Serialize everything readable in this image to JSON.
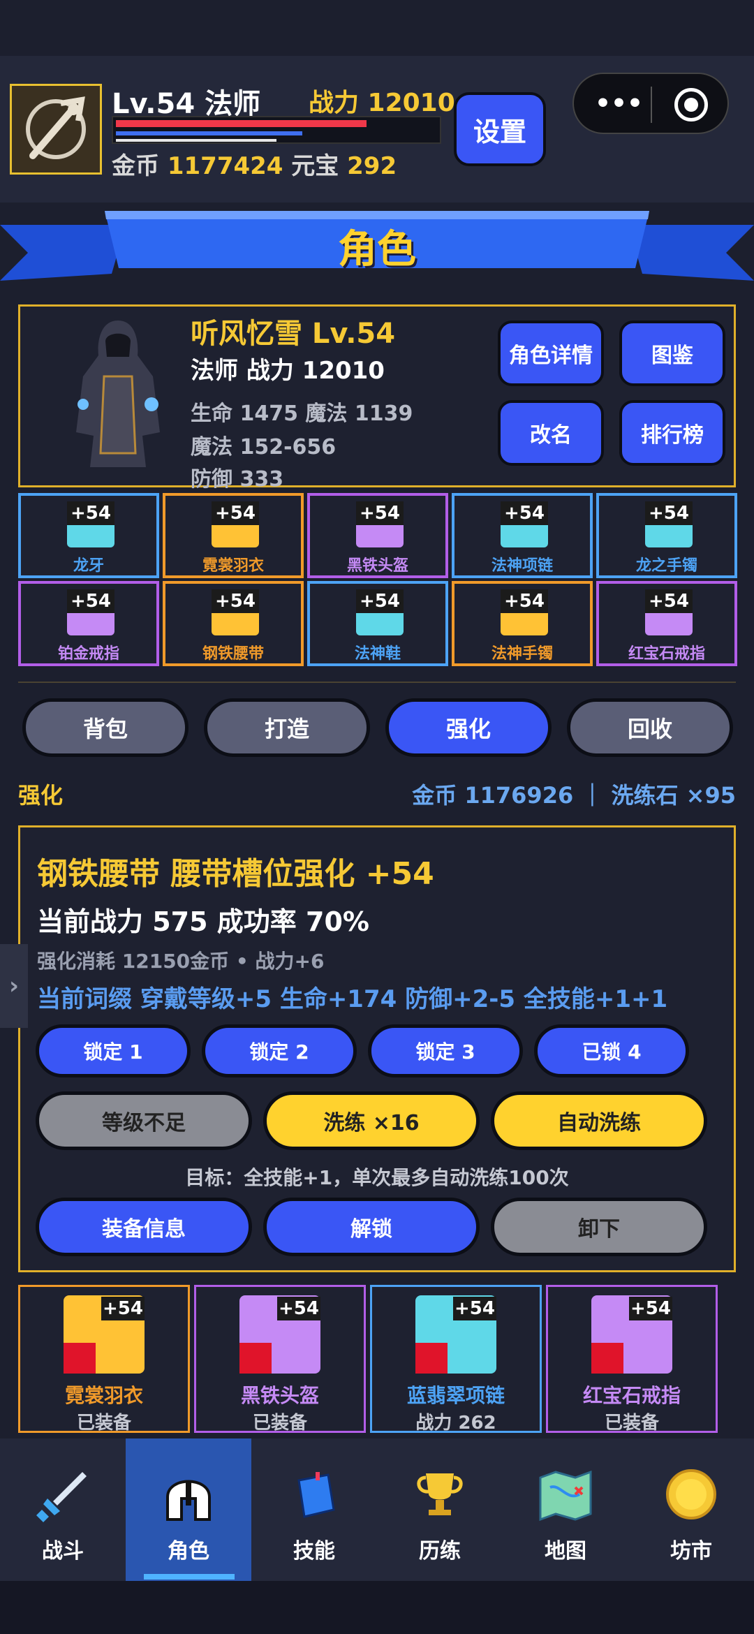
{
  "header": {
    "level_label": "Lv.54 法师",
    "power_label": "战力 12010",
    "gold_label": "金币",
    "gold_value": "1177424",
    "yuanbao_label": "元宝",
    "yuanbao_value": "292",
    "hp_fraction": 0.78,
    "mp_fraction": 0.58,
    "xp_fraction": 0.5,
    "settings_label": "设置"
  },
  "capsule": {
    "menu_icon": "more-dots-icon",
    "close_icon": "target-circle-icon"
  },
  "page": {
    "title": "角色"
  },
  "character": {
    "name_line": "听风忆雪  Lv.54",
    "class_line": "法师  战力 12010",
    "stat_hp_mp": "生命 1475  魔法 1139",
    "stat_magic": "魔法 152-656",
    "stat_defense": "防御 333",
    "buttons": [
      "角色详情",
      "图鉴",
      "改名",
      "排行榜"
    ]
  },
  "equipment_slots": [
    {
      "level": "+54",
      "name": "龙牙",
      "color": "#4da3f5",
      "icon_bg": "#5fd8e8",
      "name_color": "#4da3f5"
    },
    {
      "level": "+54",
      "name": "霓裳羽衣",
      "color": "#f09a2a",
      "icon_bg": "#ffc235",
      "name_color": "#f09a2a"
    },
    {
      "level": "+54",
      "name": "黑铁头盔",
      "color": "#b25ee8",
      "icon_bg": "#c58af5",
      "name_color": "#c58af5"
    },
    {
      "level": "+54",
      "name": "法神项链",
      "color": "#4da3f5",
      "icon_bg": "#5fd8e8",
      "name_color": "#4da3f5"
    },
    {
      "level": "+54",
      "name": "龙之手镯",
      "color": "#4da3f5",
      "icon_bg": "#5fd8e8",
      "name_color": "#4da3f5"
    },
    {
      "level": "+54",
      "name": "铂金戒指",
      "color": "#b25ee8",
      "icon_bg": "#c58af5",
      "name_color": "#c58af5"
    },
    {
      "level": "+54",
      "name": "钢铁腰带",
      "color": "#f09a2a",
      "icon_bg": "#ffc235",
      "name_color": "#f09a2a"
    },
    {
      "level": "+54",
      "name": "法神鞋",
      "color": "#4da3f5",
      "icon_bg": "#5fd8e8",
      "name_color": "#4da3f5"
    },
    {
      "level": "+54",
      "name": "法神手镯",
      "color": "#f09a2a",
      "icon_bg": "#ffc235",
      "name_color": "#f09a2a"
    },
    {
      "level": "+54",
      "name": "红宝石戒指",
      "color": "#b25ee8",
      "icon_bg": "#c58af5",
      "name_color": "#c58af5"
    }
  ],
  "tabs": [
    {
      "label": "背包",
      "active": false
    },
    {
      "label": "打造",
      "active": false
    },
    {
      "label": "强化",
      "active": true
    },
    {
      "label": "回收",
      "active": false
    }
  ],
  "section": {
    "title": "强化",
    "resources": "金币 1176926 ｜ 洗练石 ×95"
  },
  "enhance": {
    "title": "钢铁腰带  腰带槽位强化 +54",
    "power_line": "当前战力 575  成功率 70%",
    "cost_line": "强化消耗 12150金币 • 战力+6",
    "affix_line": "当前词缀  穿戴等级+5  生命+174  防御+2-5  全技能+1+1",
    "locks": [
      "锁定 1",
      "锁定 2",
      "锁定 3",
      "已锁 4"
    ],
    "btn_level": "等级不足",
    "btn_refine": "洗练 ×16",
    "btn_auto": "自动洗练",
    "target_line": "目标：全技能+1，单次最多自动洗练100次",
    "btn_info": "装备信息",
    "btn_unlock": "解锁",
    "btn_remove": "卸下"
  },
  "bag_cards": [
    {
      "level": "+54",
      "name": "霓裳羽衣",
      "status": "已装备",
      "border": "#f09a2a",
      "icon_bg": "#ffc235",
      "name_color": "#f09a2a"
    },
    {
      "level": "+54",
      "name": "黑铁头盔",
      "status": "已装备",
      "border": "#b25ee8",
      "icon_bg": "#c58af5",
      "name_color": "#c58af5"
    },
    {
      "level": "+54",
      "name": "蓝翡翠项链",
      "status": "战力 262",
      "border": "#4da3f5",
      "icon_bg": "#5fd8e8",
      "name_color": "#4da3f5"
    },
    {
      "level": "+54",
      "name": "红宝石戒指",
      "status": "已装备",
      "border": "#b25ee8",
      "icon_bg": "#c58af5",
      "name_color": "#c58af5"
    }
  ],
  "nav": [
    {
      "label": "战斗",
      "icon": "sword-icon",
      "active": false
    },
    {
      "label": "角色",
      "icon": "helmet-icon",
      "active": true
    },
    {
      "label": "技能",
      "icon": "skill-book-icon",
      "active": false
    },
    {
      "label": "历练",
      "icon": "trophy-icon",
      "active": false
    },
    {
      "label": "地图",
      "icon": "map-icon",
      "active": false
    },
    {
      "label": "坊市",
      "icon": "coin-icon",
      "active": false
    }
  ],
  "colors": {
    "accent_blue": "#3a56f5",
    "gold": "#f6c935",
    "panel_border": "#e0b02a"
  }
}
